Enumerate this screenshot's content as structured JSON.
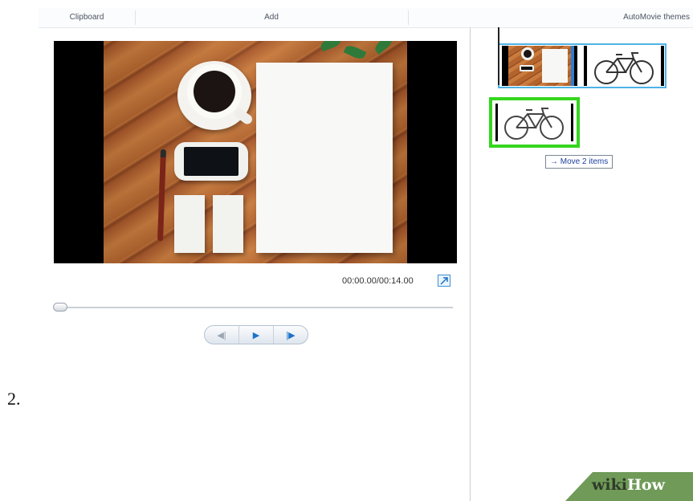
{
  "ribbon": {
    "groups": [
      "Clipboard",
      "Add",
      "AutoMovie themes"
    ]
  },
  "preview": {
    "time_display": "00:00.00/00:14.00",
    "controls": {
      "prev_frame": "◀|",
      "play": "▶",
      "next_frame": "|▶"
    },
    "fullscreen_icon": "expand-icon"
  },
  "storyboard": {
    "tooltip": "→ Move 2 items",
    "selection_color": "#4fb3e6",
    "drag_highlight_color": "#35d61e"
  },
  "step_label": "2.",
  "watermark": {
    "part1": "wiki",
    "part2": "How"
  }
}
